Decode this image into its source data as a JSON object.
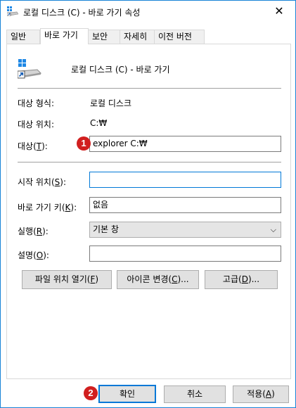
{
  "window": {
    "title": "로컬 디스크 (C) - 바로 가기 속성",
    "close_glyph": "✕"
  },
  "tabs": [
    {
      "label": "일반",
      "active": false
    },
    {
      "label": "바로 가기",
      "active": true
    },
    {
      "label": "보안",
      "active": false
    },
    {
      "label": "자세히",
      "active": false
    },
    {
      "label": "이전 버전",
      "active": false
    }
  ],
  "header": {
    "name": "로컬 디스크 (C) - 바로 가기",
    "icon": "drive-shortcut-icon"
  },
  "info": {
    "target_type_label": "대상 형식:",
    "target_type_value": "로컬 디스크",
    "target_location_label": "대상 위치:",
    "target_location_value": "C:₩"
  },
  "target": {
    "label": "대상(T):",
    "label_text": "대상(",
    "label_key": "T",
    "label_end": "):",
    "value": "explorer C:₩",
    "badge": "1"
  },
  "start_in": {
    "label_text": "시작 위치(",
    "label_key": "S",
    "label_end": "):",
    "value": ""
  },
  "shortcut_key": {
    "label_text": "바로 가기 키(",
    "label_key": "K",
    "label_end": "):",
    "value": "없음"
  },
  "run": {
    "label_text": "실행(",
    "label_key": "R",
    "label_end": "):",
    "value": "기본 창"
  },
  "comment": {
    "label_text": "설명(",
    "label_key": "O",
    "label_end": "):",
    "value": ""
  },
  "buttons": {
    "open_location_text": "파일 위치 열기(",
    "open_location_key": "F",
    "open_location_end": ")",
    "change_icon_text": "아이콘 변경(",
    "change_icon_key": "C",
    "change_icon_end": ")...",
    "advanced_text": "고급(",
    "advanced_key": "D",
    "advanced_end": ")...",
    "ok": "확인",
    "cancel": "취소",
    "apply_text": "적용(",
    "apply_key": "A",
    "apply_end": ")",
    "ok_badge": "2"
  },
  "colors": {
    "accent": "#0078d7",
    "badge": "#d11f1f"
  }
}
